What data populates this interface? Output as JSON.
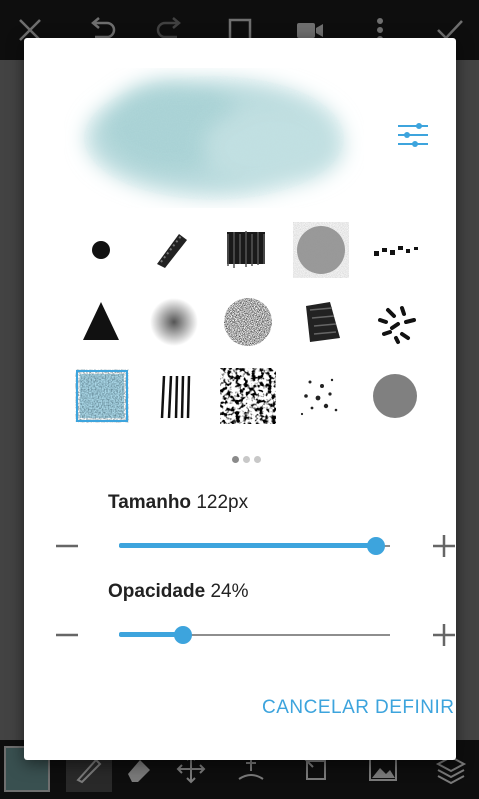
{
  "toolbar_top": {
    "icons": [
      "close-icon",
      "undo-icon",
      "redo-icon",
      "fullscreen-icon",
      "video-record-icon",
      "more-vert-icon",
      "check-icon"
    ]
  },
  "toolbar_bottom": {
    "icons": [
      "color-swatch",
      "brush-icon",
      "eraser-icon",
      "move-icon",
      "smudge-icon",
      "transform-icon",
      "image-icon",
      "layers-icon"
    ],
    "current_color": "#4f6f70"
  },
  "dialog": {
    "brushes": [
      {
        "name": "round-hard-brush-icon",
        "selected": false
      },
      {
        "name": "chalk-brush-icon",
        "selected": false
      },
      {
        "name": "charcoal-brush-icon",
        "selected": false
      },
      {
        "name": "noise-circle-brush-icon",
        "selected": false
      },
      {
        "name": "dotted-line-brush-icon",
        "selected": false
      },
      {
        "name": "triangle-brush-icon",
        "selected": false
      },
      {
        "name": "soft-round-brush-icon",
        "selected": false
      },
      {
        "name": "spray-brush-icon",
        "selected": false
      },
      {
        "name": "rough-brush-icon",
        "selected": false
      },
      {
        "name": "scatter-brush-icon",
        "selected": false
      },
      {
        "name": "texture-square-brush-icon",
        "selected": true
      },
      {
        "name": "lines-brush-icon",
        "selected": false
      },
      {
        "name": "splatter-brush-icon",
        "selected": false
      },
      {
        "name": "speckle-brush-icon",
        "selected": false
      },
      {
        "name": "gray-circle-brush-icon",
        "selected": false
      }
    ],
    "pager": {
      "pages": 3,
      "current": 1
    },
    "size": {
      "label": "Tamanho",
      "value": "122px",
      "fraction": 0.95
    },
    "opacity": {
      "label": "Opacidade",
      "value": "24%",
      "fraction": 0.24
    },
    "cancel_label": "CANCELAR",
    "confirm_label": "DEFINIR",
    "accent": "#3da4dd"
  }
}
